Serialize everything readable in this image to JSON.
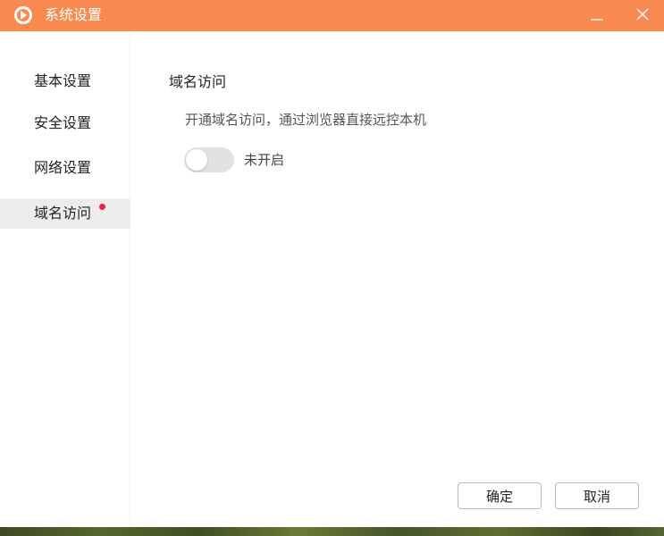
{
  "window": {
    "title": "系统设置",
    "icon": "app-logo-icon",
    "controls": {
      "minimize_icon": "minimize-icon",
      "close_icon": "close-icon"
    },
    "title_bar_color": "#f9894e"
  },
  "sidebar": {
    "items": [
      {
        "label": "基本设置",
        "active": false,
        "badge": false
      },
      {
        "label": "安全设置",
        "active": false,
        "badge": false
      },
      {
        "label": "网络设置",
        "active": false,
        "badge": false
      },
      {
        "label": "域名访问",
        "active": true,
        "badge": true
      }
    ],
    "badge_color": "#ee1f4f"
  },
  "main": {
    "section_title": "域名访问",
    "description": "开通域名访问，通过浏览器直接远控本机",
    "toggle": {
      "enabled": false,
      "status_label": "未开启"
    }
  },
  "footer": {
    "ok_label": "确定",
    "cancel_label": "取消"
  }
}
